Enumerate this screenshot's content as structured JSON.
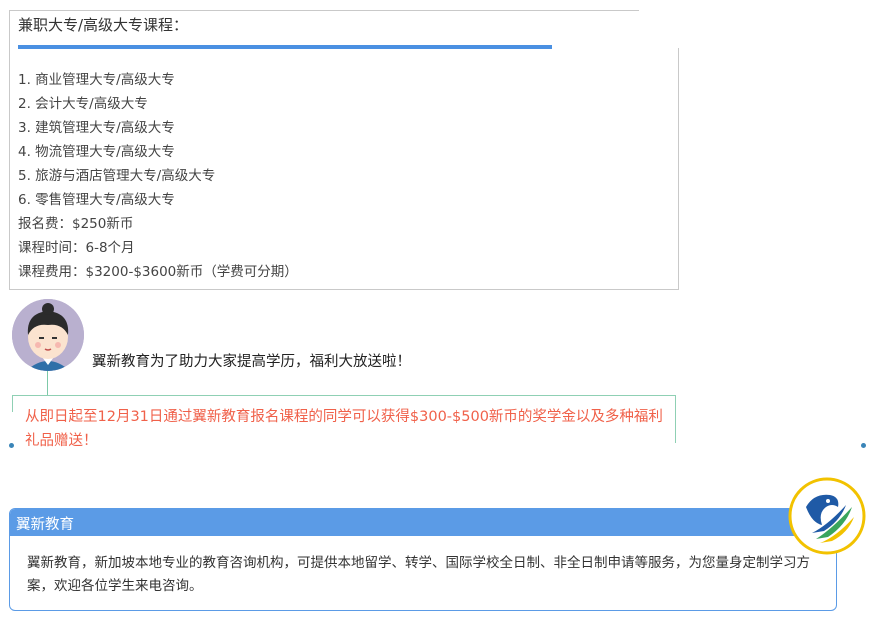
{
  "course_section": {
    "title": "兼职大专/高级大专课程：",
    "items": [
      "1. 商业管理大专/高级大专",
      "2. 会计大专/高级大专",
      "3. 建筑管理大专/高级大专",
      "4. 物流管理大专/高级大专",
      "5. 旅游与酒店管理大专/高级大专",
      "6. 零售管理大专/高级大专",
      "报名费：$250新币",
      "课程时间：6-8个月",
      "课程费用：$3200-$3600新币（学费可分期）"
    ]
  },
  "promo": {
    "headline": "翼新教育为了助力大家提高学历，福利大放送啦！",
    "notice": "从即日起至12月31日通过翼新教育报名课程的同学可以获得$300-$500新币的奖学金以及多种福利礼品赠送！"
  },
  "org": {
    "title": "翼新教育",
    "description": "翼新教育，新加坡本地专业的教育咨询机构，可提供本地留学、转学、国际学校全日制、非全日制申请等服务，为您量身定制学习方案，欢迎各位学生来电咨询。"
  },
  "colors": {
    "accent_blue": "#4a90e2",
    "notice_red": "#f0614a",
    "header_blue": "#5b9be6"
  }
}
